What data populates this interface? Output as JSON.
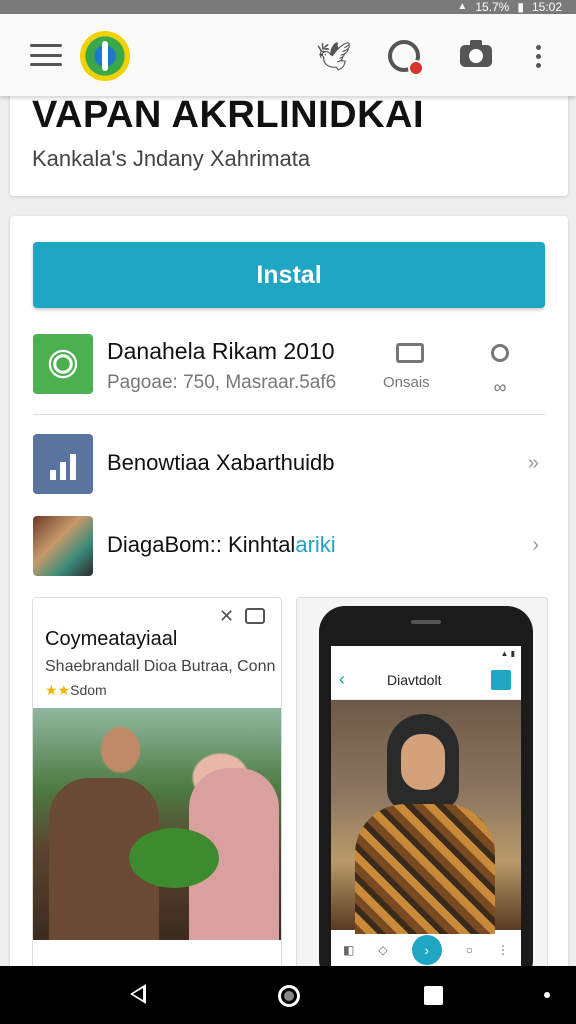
{
  "status_bar": {
    "battery": "15.7%",
    "time": "15:02"
  },
  "header": {
    "title": "VAPAN AKRLINIDKAI",
    "subtitle": "Kankala's Jndany Xahrimata"
  },
  "install": {
    "label": "Instal"
  },
  "app_info": {
    "name": "Danahela Rikam 2010",
    "meta": "Pagoae: 750, Masraar.5af6",
    "control_label": "Onsais"
  },
  "list": {
    "item1_label": "Benowtiaa Xabarthuidb",
    "item2_label_prefix": "DiagaBom:: Kinhtal",
    "item2_label_accent": "ariki"
  },
  "preview_a": {
    "title": "Coymeatayiaal",
    "subtitle": "Shaebrandall Dioa Butraa, Conn",
    "rating_stars": "★★",
    "rating_text": "Sdom"
  },
  "preview_b": {
    "screen_title": "Diavtdolt"
  },
  "icons": {
    "menu": "menu-icon",
    "bird": "bird-icon",
    "account": "account-icon",
    "camera": "camera-icon",
    "more": "more-vert-icon",
    "folder": "folder-icon",
    "settings": "settings-icon",
    "link": "link-icon"
  },
  "colors": {
    "accent": "#1ea6c2",
    "green": "#4caf50",
    "badge": "#d9342b"
  }
}
